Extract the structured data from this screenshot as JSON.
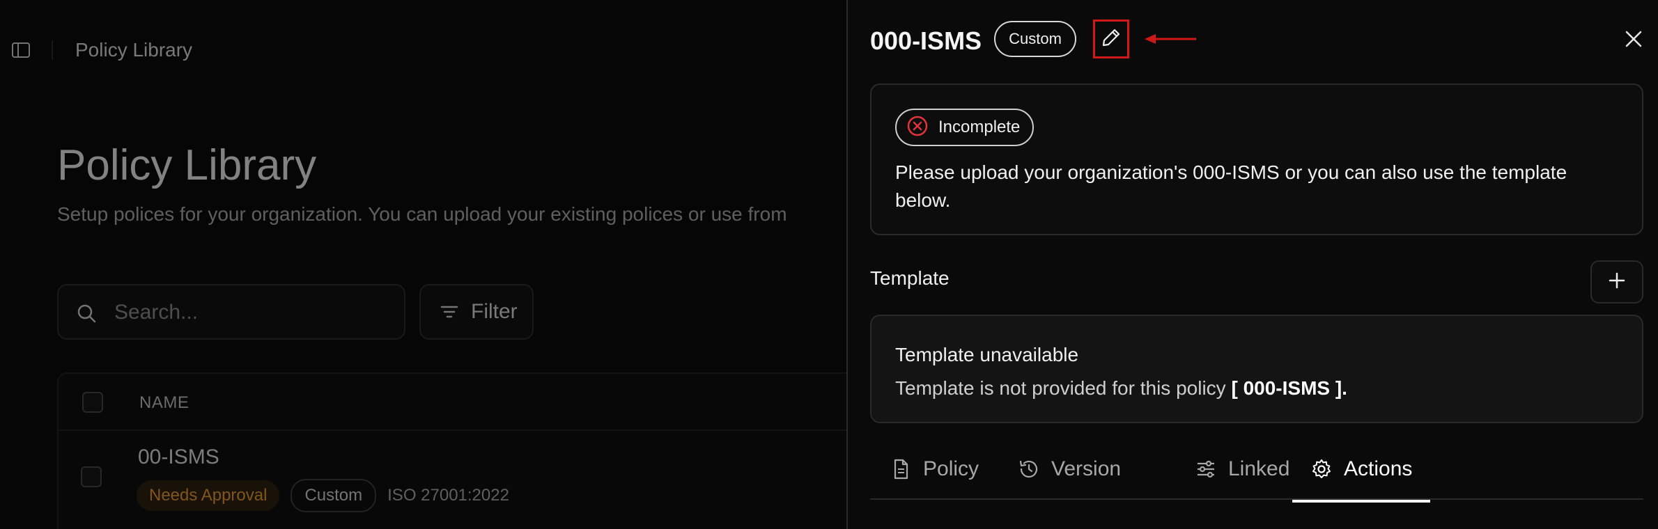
{
  "background": {
    "breadcrumb": "Policy Library",
    "title": "Policy Library",
    "subtitle": "Setup polices for your organization. You can upload your existing polices or use from",
    "search": {
      "placeholder": "Search..."
    },
    "filter_label": "Filter",
    "table": {
      "headers": [
        "NAME"
      ],
      "rows": [
        {
          "name": "00-ISMS",
          "status": "Needs Approval",
          "type": "Custom",
          "framework": "ISO 27001:2022"
        }
      ]
    }
  },
  "panel": {
    "title": "000-ISMS",
    "type_badge": "Custom",
    "status": {
      "label": "Incomplete",
      "message": "Please upload your organization's 000-ISMS or you can also use the template below."
    },
    "template_section": {
      "label": "Template",
      "card_title": "Template unavailable",
      "card_desc_prefix": "Template is not provided for this policy",
      "card_desc_policy": "[ 000-ISMS ]."
    },
    "tabs": [
      {
        "label": "Policy",
        "icon": "document-icon"
      },
      {
        "label": "Version",
        "icon": "history-icon"
      },
      {
        "label": "Linked",
        "icon": "sliders-icon"
      },
      {
        "label": "Actions",
        "icon": "gear-icon",
        "active": true
      }
    ]
  },
  "colors": {
    "highlight": "#d01818",
    "approval": "#e6962e",
    "error": "#e0343a"
  }
}
